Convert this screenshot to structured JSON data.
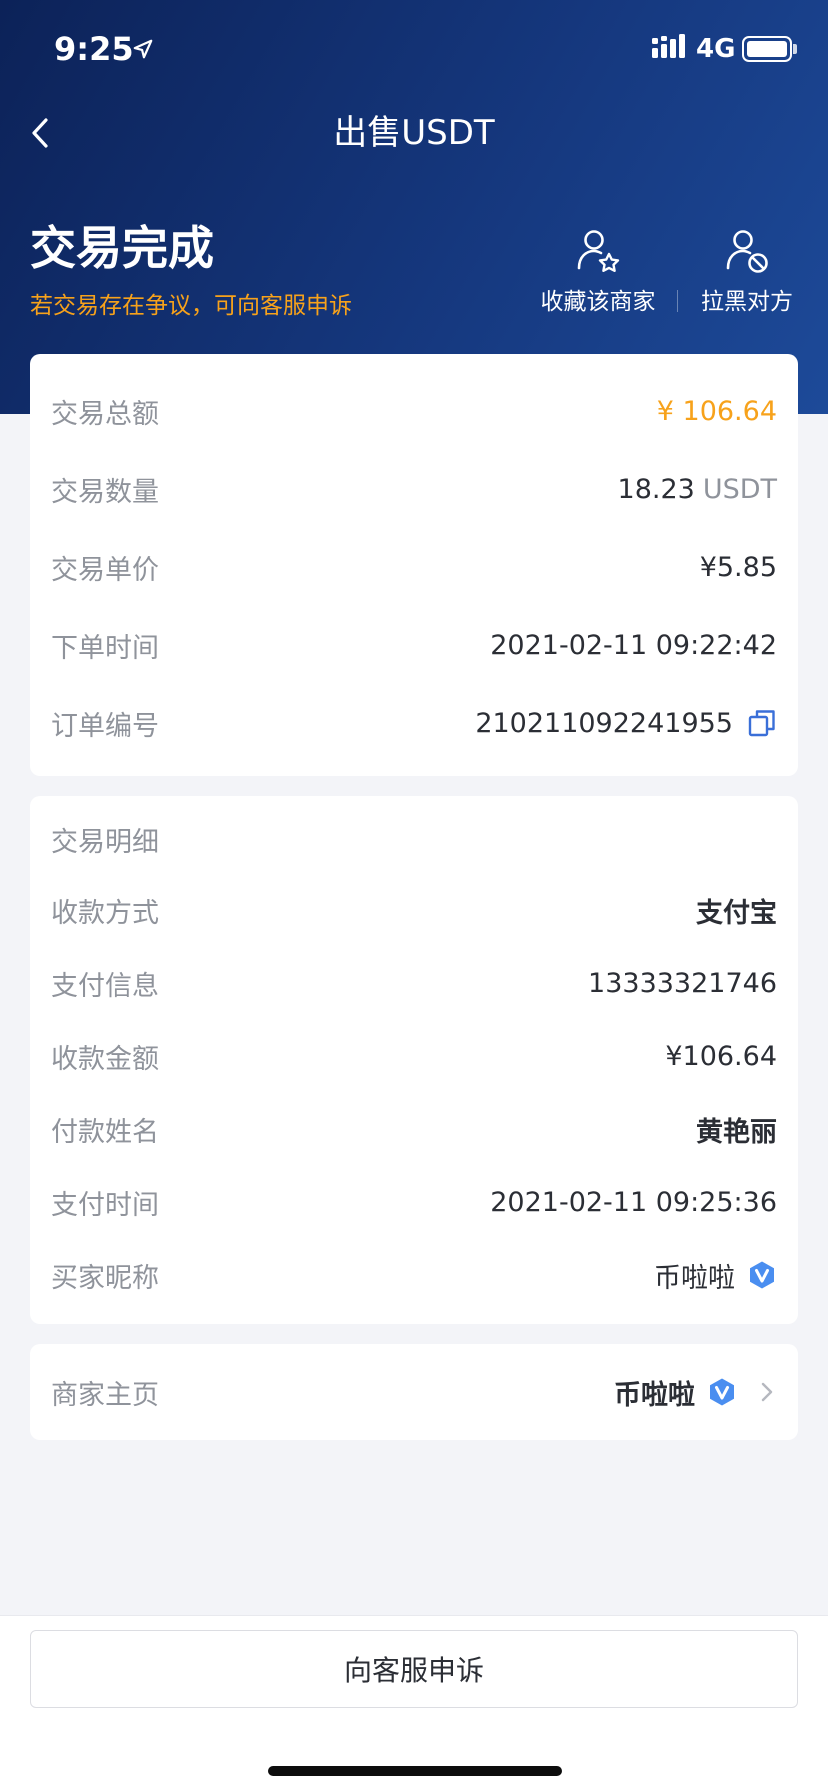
{
  "status_bar": {
    "time": "9:25",
    "network": "4G"
  },
  "nav": {
    "title": "出售USDT"
  },
  "status": {
    "title": "交易完成",
    "subtitle": "若交易存在争议，可向客服申诉",
    "favorite_label": "收藏该商家",
    "block_label": "拉黑对方"
  },
  "summary": {
    "total_label": "交易总额",
    "total_value": "¥ 106.64",
    "quantity_label": "交易数量",
    "quantity_value": "18.23",
    "quantity_unit": "USDT",
    "price_label": "交易单价",
    "price_value": "¥5.85",
    "order_time_label": "下单时间",
    "order_time_value": "2021-02-11 09:22:42",
    "order_no_label": "订单编号",
    "order_no_value": "210211092241955"
  },
  "details": {
    "section_label": "交易明细",
    "method_label": "收款方式",
    "method_value": "支付宝",
    "pay_info_label": "支付信息",
    "pay_info_value": "13333321746",
    "amount_label": "收款金额",
    "amount_value": "¥106.64",
    "payer_label": "付款姓名",
    "payer_value": "黄艳丽",
    "pay_time_label": "支付时间",
    "pay_time_value": "2021-02-11 09:25:36",
    "buyer_label": "买家昵称",
    "buyer_value": "币啦啦"
  },
  "merchant": {
    "label": "商家主页",
    "value": "币啦啦"
  },
  "bottom": {
    "appeal_label": "向客服申诉"
  },
  "colors": {
    "accent_orange": "#f7a21b",
    "header_blue": "#15377d",
    "badge_blue": "#3b82f6"
  },
  "icons": [
    "location-arrow-icon",
    "signal-icon",
    "battery-icon",
    "back-chevron-icon",
    "user-star-icon",
    "user-block-icon",
    "copy-icon",
    "verified-badge-icon",
    "chevron-right-icon"
  ]
}
